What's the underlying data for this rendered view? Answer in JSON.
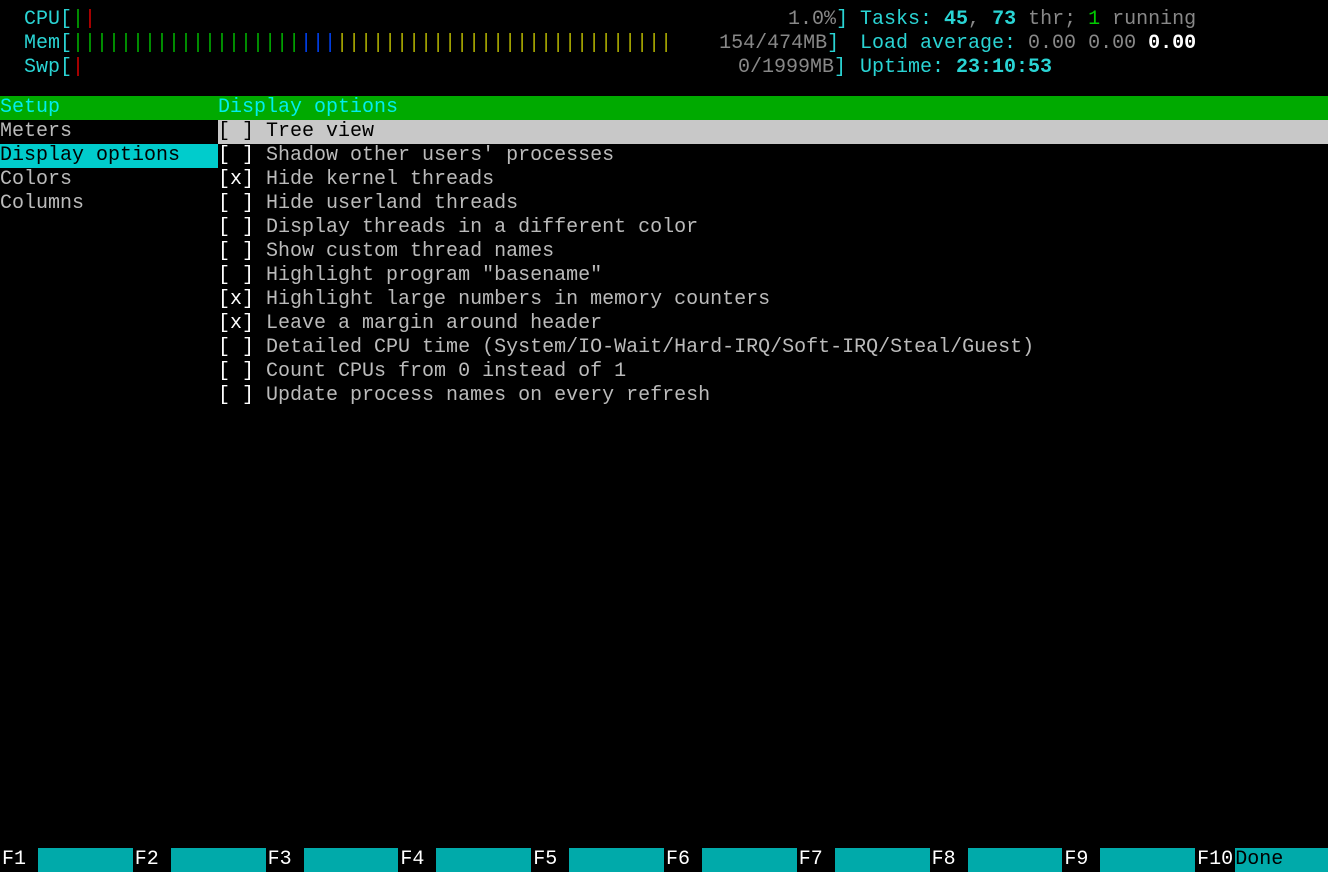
{
  "meters": {
    "cpu": {
      "label": "CPU",
      "value": "1.0%"
    },
    "mem": {
      "label": "Mem",
      "value": "154/474MB"
    },
    "swp": {
      "label": "Swp",
      "value": "0/1999MB"
    }
  },
  "status": {
    "tasks_label": "Tasks:",
    "tasks": "45",
    "threads_sep": ", ",
    "threads": "73",
    "threads_suffix": " thr; ",
    "running": "1",
    "running_suffix": " running",
    "load_label": "Load average:",
    "load1": "0.00",
    "load2": "0.00",
    "load3": "0.00",
    "uptime_label": "Uptime:",
    "uptime": "23:10:53"
  },
  "panel": {
    "sidebar_title": "Setup",
    "content_title": "Display options",
    "sidebar": [
      {
        "label": "Meters",
        "selected": false
      },
      {
        "label": "Display options",
        "selected": true
      },
      {
        "label": "Colors",
        "selected": false
      },
      {
        "label": "Columns",
        "selected": false
      }
    ],
    "options": [
      {
        "checked": false,
        "highlight": true,
        "label": "Tree view"
      },
      {
        "checked": false,
        "highlight": false,
        "label": "Shadow other users' processes"
      },
      {
        "checked": true,
        "highlight": false,
        "label": "Hide kernel threads"
      },
      {
        "checked": false,
        "highlight": false,
        "label": "Hide userland threads"
      },
      {
        "checked": false,
        "highlight": false,
        "label": "Display threads in a different color"
      },
      {
        "checked": false,
        "highlight": false,
        "label": "Show custom thread names"
      },
      {
        "checked": false,
        "highlight": false,
        "label": "Highlight program \"basename\""
      },
      {
        "checked": true,
        "highlight": false,
        "label": "Highlight large numbers in memory counters"
      },
      {
        "checked": true,
        "highlight": false,
        "label": "Leave a margin around header"
      },
      {
        "checked": false,
        "highlight": false,
        "label": "Detailed CPU time (System/IO-Wait/Hard-IRQ/Soft-IRQ/Steal/Guest)"
      },
      {
        "checked": false,
        "highlight": false,
        "label": "Count CPUs from 0 instead of 1"
      },
      {
        "checked": false,
        "highlight": false,
        "label": "Update process names on every refresh"
      }
    ]
  },
  "fnkeys": [
    {
      "key": "F1",
      "label": ""
    },
    {
      "key": "F2",
      "label": ""
    },
    {
      "key": "F3",
      "label": ""
    },
    {
      "key": "F4",
      "label": ""
    },
    {
      "key": "F5",
      "label": ""
    },
    {
      "key": "F6",
      "label": ""
    },
    {
      "key": "F7",
      "label": ""
    },
    {
      "key": "F8",
      "label": ""
    },
    {
      "key": "F9",
      "label": ""
    },
    {
      "key": "F10",
      "label": "Done"
    }
  ]
}
